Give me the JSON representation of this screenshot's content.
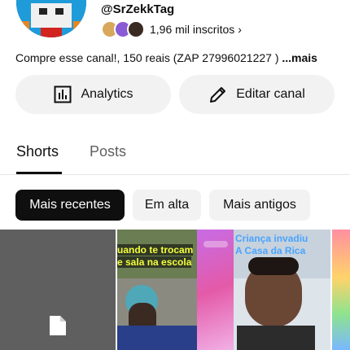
{
  "channel": {
    "handle": "@SrZekkTag",
    "subscribers": "1,96 mil inscritos",
    "subscribers_chevron": "›",
    "description": "Compre esse canal!, 150 reais (ZAP 27996021227 ) ",
    "description_more": "...mais"
  },
  "actions": {
    "analytics_label": "Analytics",
    "edit_label": "Editar canal"
  },
  "tabs": [
    {
      "label": "Shorts",
      "active": true
    },
    {
      "label": "Posts",
      "active": false
    }
  ],
  "filters": [
    {
      "label": "Mais recentes",
      "selected": true
    },
    {
      "label": "Em alta",
      "selected": false
    },
    {
      "label": "Mais antigos",
      "selected": false
    }
  ],
  "shorts": [
    {
      "caption_line1": "",
      "caption_line2": "",
      "icon": "file-icon"
    },
    {
      "caption_line1": "uando te trocam",
      "caption_line2": "e sala na escola"
    },
    {
      "caption_line1": "",
      "caption_line2": ""
    },
    {
      "caption_line1": "Criança invadiu",
      "caption_line2": "A Casa da Rica"
    },
    {
      "caption_line1": "",
      "caption_line2": ""
    }
  ],
  "colors": {
    "accent_dark": "#0f0f0f",
    "chip_bg": "#f2f2f2",
    "muted_text": "#606060",
    "caption_yellow": "#f4ff3a",
    "caption_blue": "#4aa3ff"
  }
}
